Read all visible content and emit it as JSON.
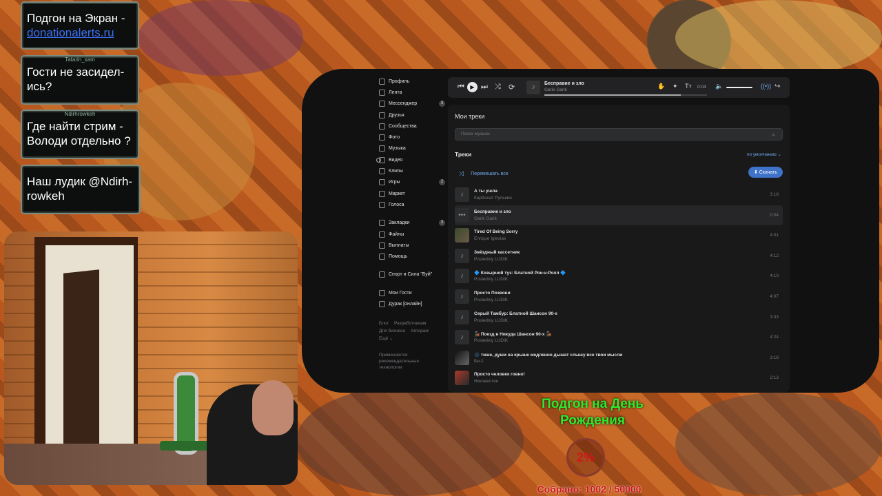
{
  "chat": [
    {
      "user": "",
      "text": "Подгон на Экран -",
      "link": "donationalerts.ru"
    },
    {
      "user": "Tatarin_xam",
      "text": "Гости не засидел-ись?"
    },
    {
      "user": "Ndirhrowkeh",
      "text": "Где найти стрим - Володи отдельно ?"
    },
    {
      "user": "",
      "text": "Наш лудик @Ndirh-rowkeh"
    }
  ],
  "sidebar": {
    "items": [
      {
        "label": "Профиль"
      },
      {
        "label": "Лента"
      },
      {
        "label": "Мессенджер",
        "badge": "3"
      },
      {
        "label": "Друзья"
      },
      {
        "label": "Сообщества"
      },
      {
        "label": "Фото"
      },
      {
        "label": "Музыка"
      },
      {
        "label": "Видео"
      },
      {
        "label": "Клипы"
      },
      {
        "label": "Игры",
        "badge": "2"
      },
      {
        "label": "Маркет"
      },
      {
        "label": "Голоса"
      }
    ],
    "items2": [
      {
        "label": "Закладки",
        "badge": "3"
      },
      {
        "label": "Файлы"
      },
      {
        "label": "Выплаты"
      },
      {
        "label": "Помощь"
      }
    ],
    "group": "Спорт и Сила \"Буй\"",
    "apps": [
      {
        "label": "Мои Гости"
      },
      {
        "label": "Дурак [онлайн]"
      }
    ],
    "footer": [
      "Блог",
      "Разработчикам",
      "Для бизнеса",
      "Авторам",
      "Ещё ⌄"
    ],
    "note": "Применяются рекомендательные технологии"
  },
  "player": {
    "title": "Бесправие и зло",
    "artist": "Garik Garik",
    "time": "0:04",
    "progress": 0.84
  },
  "music": {
    "heading": "Мои треки",
    "search_placeholder": "Поиск музыки",
    "tracks_title": "Треки",
    "sort_label": "по умолчанию ⌄",
    "shuffle_label": "Перемешать все",
    "download_label": "Скачать",
    "tracks": [
      {
        "name": "А ты ушла",
        "artist": "Карбонат Рулькин",
        "dur": "3:18"
      },
      {
        "name": "Бесправие и зло",
        "artist": "Garik Garik",
        "dur": "0:04",
        "current": true
      },
      {
        "name": "Tired Of Being Sorry",
        "artist": "Enrique Iglesias",
        "dur": "4:01",
        "cover": "photo"
      },
      {
        "name": "Звёздный кассетник",
        "artist": "Posledniy LUDIK",
        "dur": "4:12"
      },
      {
        "name": "🔷 Козырной туз: Блатной Рок-н-Ролл 🔷",
        "artist": "Posledniy LUDIK",
        "dur": "4:10"
      },
      {
        "name": "Просто Позвони",
        "artist": "Posledniy LUDIK",
        "dur": "4:07"
      },
      {
        "name": "Серый Тамбур: Блатной Шансон 90-х",
        "artist": "Posledniy LUDIK",
        "dur": "3:33"
      },
      {
        "name": "🚂 Поезд в Никуда Шансон 90-х 🚂",
        "artist": "Posledniy LUDIK",
        "dur": "4:24"
      },
      {
        "name": "🌑 тише, души на крыше медленно дышат слышу все твои мысли",
        "artist": "Би-2",
        "dur": "3:18",
        "cover": "photo2"
      },
      {
        "name": "Просто человек говно!",
        "artist": "Неизвестен",
        "dur": "2:13",
        "cover": "photo3"
      }
    ]
  },
  "goal": {
    "title": "Подгон на День Рождения",
    "percent": "2%",
    "collected": "Собрано: 1002 / 50000",
    "fraction": 0.02
  },
  "colors": {
    "accent": "#71aaeb",
    "goal_green": "#2ee82e",
    "goal_red": "#d01818"
  }
}
